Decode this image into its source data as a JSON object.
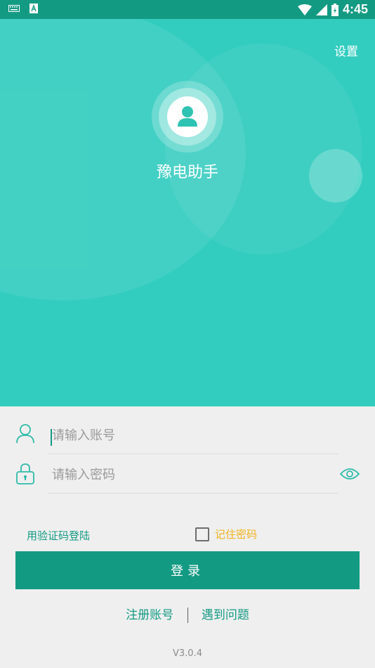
{
  "status_bar": {
    "time": "4:45",
    "left_icons": [
      "keyboard-icon",
      "notification-a-icon"
    ],
    "right_icons": [
      "wifi-icon",
      "signal-icon",
      "battery-icon"
    ]
  },
  "header": {
    "settings_label": "设置",
    "app_title": "豫电助手",
    "avatar_icon": "user-avatar-icon"
  },
  "form": {
    "account_placeholder": "请输入账号",
    "account_value": "",
    "password_placeholder": "请输入密码",
    "password_value": "",
    "sms_login_label": "用验证码登陆",
    "remember_label": "记住密码",
    "remember_checked": false,
    "login_label": "登录"
  },
  "links": {
    "register_label": "注册账号",
    "problem_label": "遇到问题"
  },
  "footer": {
    "version": "V3.0.4"
  },
  "colors": {
    "primary": "#139a83",
    "hero_bg": "#33cdbf",
    "accent_yellow": "#f2b21f"
  }
}
